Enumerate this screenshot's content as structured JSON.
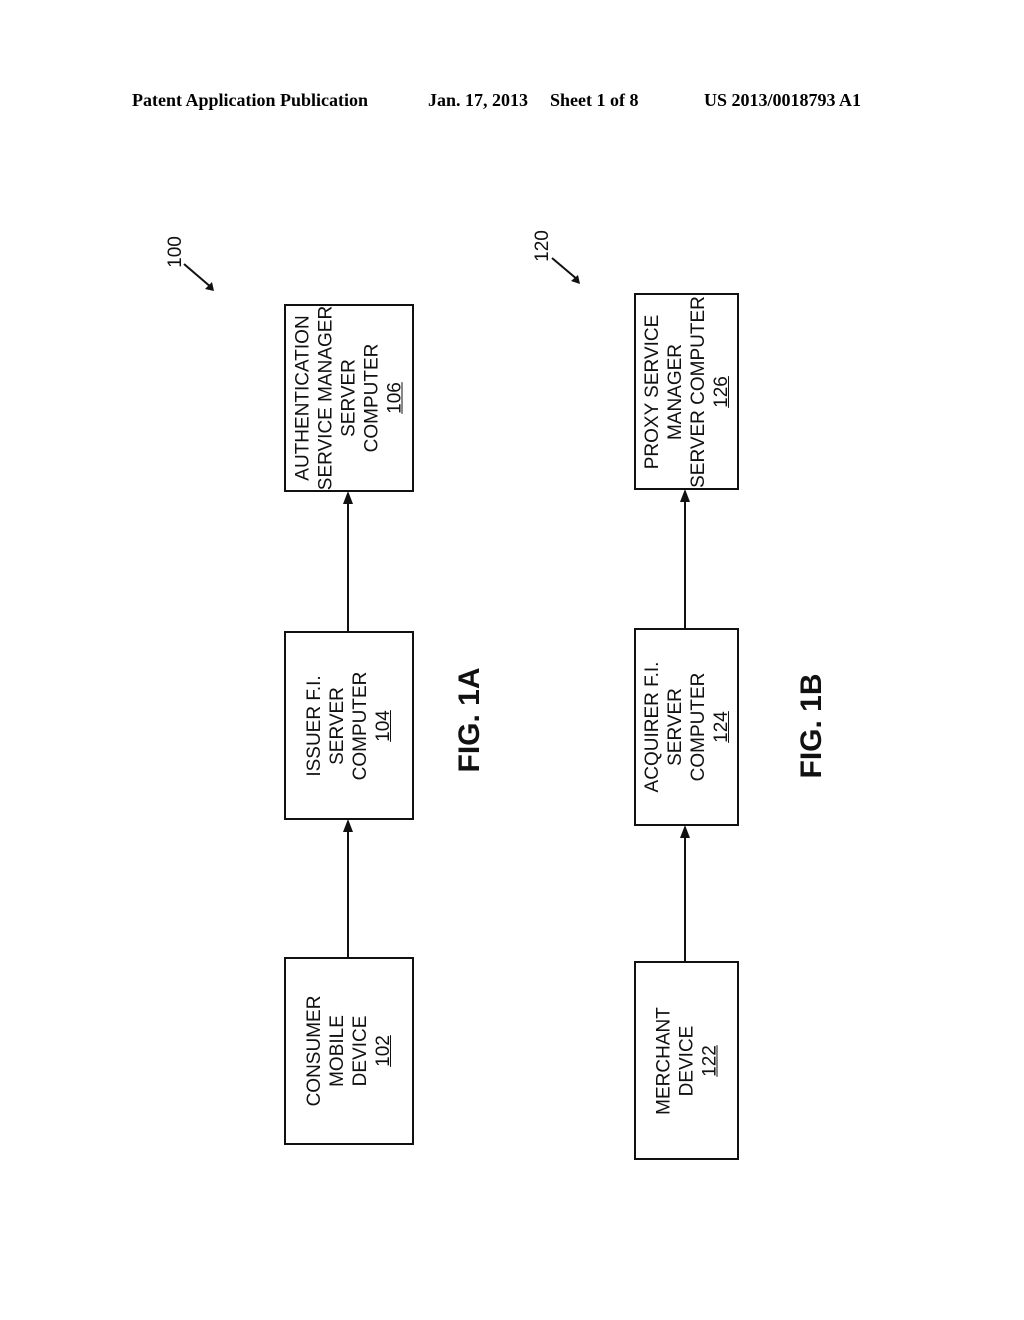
{
  "header": {
    "publication": "Patent Application Publication",
    "date": "Jan. 17, 2013",
    "sheet": "Sheet 1 of 8",
    "number": "US 2013/0018793 A1"
  },
  "figure_a": {
    "label": "FIG. 1A",
    "ref": "100",
    "boxes": [
      {
        "lines": [
          "CONSUMER",
          "MOBILE",
          "DEVICE"
        ],
        "ref": "102"
      },
      {
        "lines": [
          "ISSUER F.I.",
          "SERVER",
          "COMPUTER"
        ],
        "ref": "104"
      },
      {
        "lines": [
          "AUTHENTICATION",
          "SERVICE MANAGER",
          "SERVER",
          "COMPUTER"
        ],
        "ref": "106"
      }
    ]
  },
  "figure_b": {
    "label": "FIG. 1B",
    "ref": "120",
    "boxes": [
      {
        "lines": [
          "MERCHANT",
          "DEVICE"
        ],
        "ref": "122"
      },
      {
        "lines": [
          "ACQUIRER F.I.",
          "SERVER",
          "COMPUTER"
        ],
        "ref": "124"
      },
      {
        "lines": [
          "PROXY SERVICE",
          "MANAGER",
          "SERVER COMPUTER"
        ],
        "ref": "126"
      }
    ]
  }
}
